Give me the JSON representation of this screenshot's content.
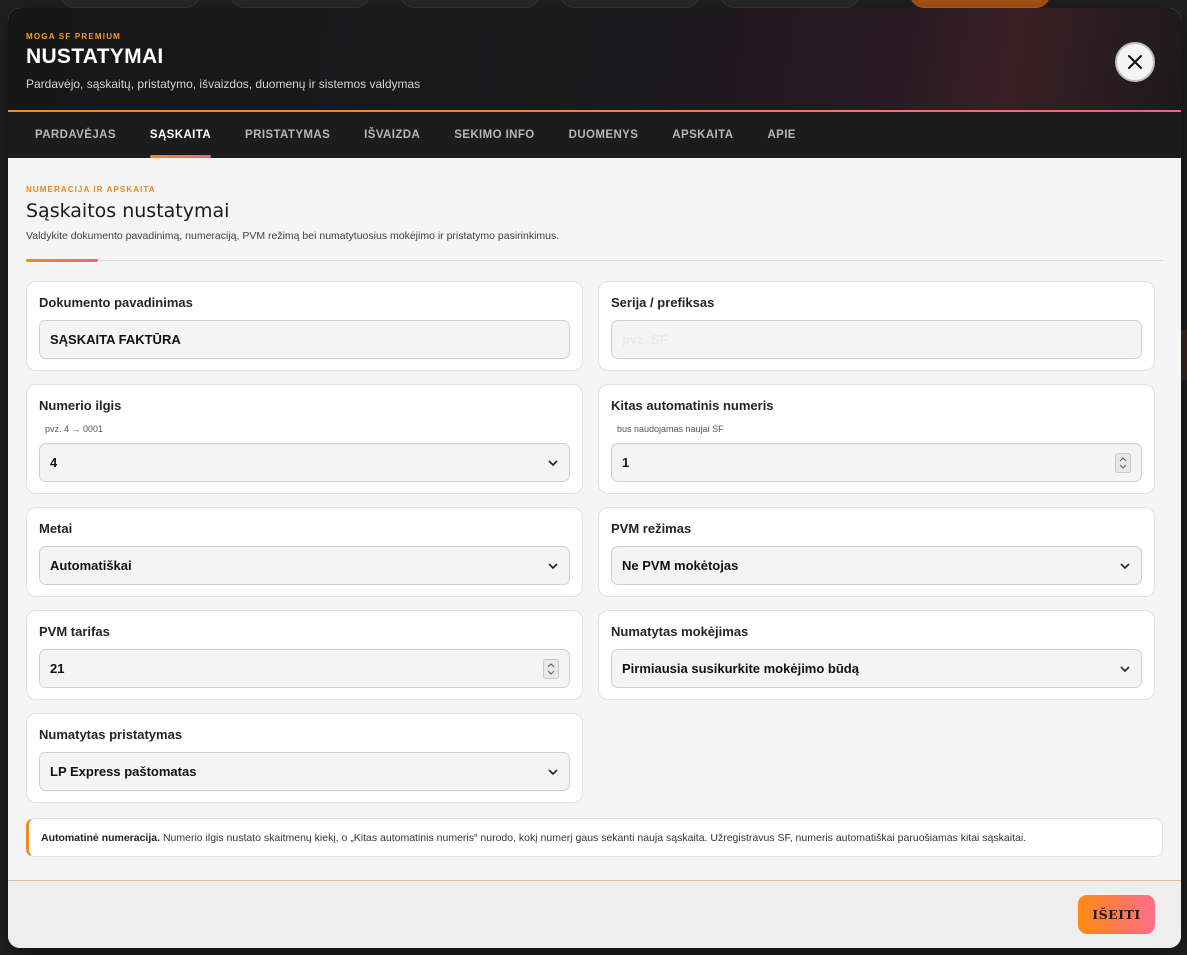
{
  "header": {
    "brand": "MOGA SF PREMIUM",
    "title": "NUSTATYMAI",
    "subtitle": "Pardavėjo, sąskaitų, pristatymo, išvaizdos, duomenų ir sistemos valdymas"
  },
  "tabs": [
    {
      "label": "PARDAVĖJAS"
    },
    {
      "label": "SĄSKAITA"
    },
    {
      "label": "PRISTATYMAS"
    },
    {
      "label": "IŠVAIZDA"
    },
    {
      "label": "SEKIMO INFO"
    },
    {
      "label": "DUOMENYS"
    },
    {
      "label": "APSKAITA"
    },
    {
      "label": "APIE"
    }
  ],
  "active_tab": "SĄSKAITA",
  "section": {
    "kicker": "NUMERACIJA IR APSKAITA",
    "title": "Sąskaitos nustatymai",
    "description": "Valdykite dokumento pavadinimą, numeraciją, PVM režimą bei numatytuosius mokėjimo ir pristatymo pasirinkimus."
  },
  "fields": {
    "doc_name": {
      "label": "Dokumento pavadinimas",
      "value": "SĄSKAITA FAKTŪRA"
    },
    "series": {
      "label": "Serija / prefiksas",
      "placeholder": "pvz. SF"
    },
    "number_length": {
      "label": "Numerio ilgis",
      "hint": "pvz. 4 → 0001",
      "value": "4"
    },
    "next_number": {
      "label": "Kitas automatinis numeris",
      "hint": "bus naudojamas naujai SF",
      "value": "1"
    },
    "year": {
      "label": "Metai",
      "value": "Automatiškai"
    },
    "vat_mode": {
      "label": "PVM režimas",
      "value": "Ne PVM mokėtojas"
    },
    "vat_rate": {
      "label": "PVM tarifas",
      "value": "21"
    },
    "default_payment": {
      "label": "Numatytas mokėjimas",
      "value": "Pirmiausia susikurkite mokėjimo būdą"
    },
    "default_delivery": {
      "label": "Numatytas pristatymas",
      "value": "LP Express paštomatas"
    }
  },
  "info": {
    "bold": "Automatinė numeracija.",
    "text": " Numerio ilgis nustato skaitmenų kiekį, o „Kitas automatinis numeris“ nurodo, kokį numerį gaus sekanti nauja sąskaita. Užregistravus SF, numeris automatiškai paruošiamas kitai sąskaitai."
  },
  "footer": {
    "exit_label": "IŠEITI"
  },
  "colors": {
    "accent_orange": "#f08a24",
    "accent_pink": "#f0608a",
    "header_bg": "#171717"
  }
}
